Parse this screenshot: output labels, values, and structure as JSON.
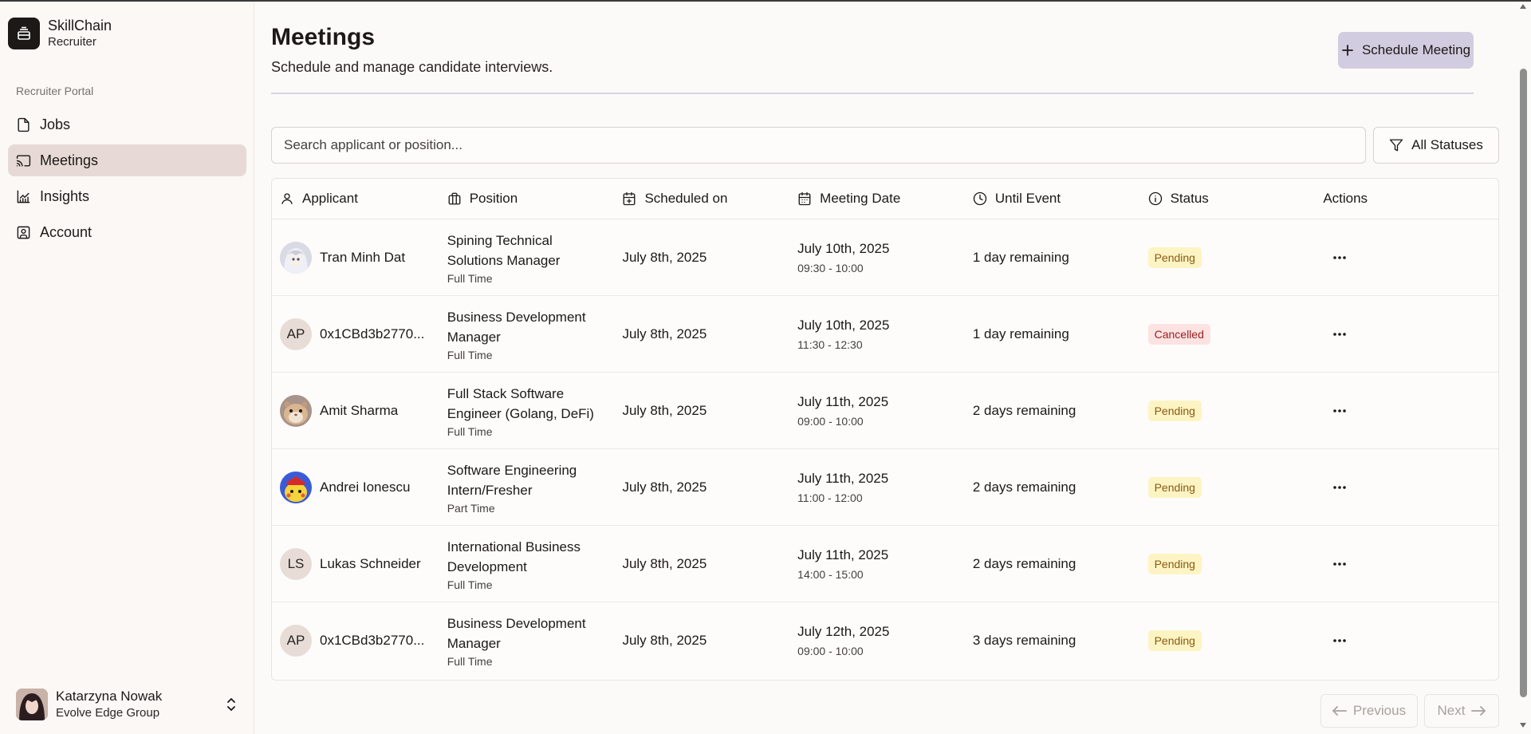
{
  "brand": {
    "name": "SkillChain",
    "subtitle": "Recruiter"
  },
  "sidebar": {
    "section_label": "Recruiter Portal",
    "items": [
      {
        "label": "Jobs",
        "icon": "file-icon",
        "active": false
      },
      {
        "label": "Meetings",
        "icon": "cast-icon",
        "active": true
      },
      {
        "label": "Insights",
        "icon": "chart-icon",
        "active": false
      },
      {
        "label": "Account",
        "icon": "contact-icon",
        "active": false
      }
    ]
  },
  "user": {
    "name": "Katarzyna Nowak",
    "org": "Evolve Edge Group"
  },
  "header": {
    "title": "Meetings",
    "subtitle": "Schedule and manage candidate interviews.",
    "schedule_label": "Schedule Meeting"
  },
  "search": {
    "placeholder": "Search applicant or position..."
  },
  "filter": {
    "label": "All Statuses"
  },
  "table": {
    "headers": [
      "Applicant",
      "Position",
      "Scheduled on",
      "Meeting Date",
      "Until Event",
      "Status",
      "Actions"
    ],
    "rows": [
      {
        "avatar": "anime-avatar-grey",
        "initials": "",
        "applicant": "Tran Minh Dat",
        "position": "Spining Technical Solutions Manager",
        "type": "Full Time",
        "scheduled": "July 8th, 2025",
        "date": "July 10th, 2025",
        "time": "09:30 - 10:00",
        "until": "1 day remaining",
        "status": "Pending"
      },
      {
        "avatar": "initials",
        "initials": "AP",
        "applicant": "0x1CBd3b2770...",
        "position": "Business Development Manager",
        "type": "Full Time",
        "scheduled": "July 8th, 2025",
        "date": "July 10th, 2025",
        "time": "11:30 - 12:30",
        "until": "1 day remaining",
        "status": "Cancelled"
      },
      {
        "avatar": "hamster-photo",
        "initials": "",
        "applicant": "Amit Sharma",
        "position": "Full Stack Software Engineer (Golang, DeFi)",
        "type": "Full Time",
        "scheduled": "July 8th, 2025",
        "date": "July 11th, 2025",
        "time": "09:00 - 10:00",
        "until": "2 days remaining",
        "status": "Pending"
      },
      {
        "avatar": "yellow-cartoon",
        "initials": "",
        "applicant": "Andrei Ionescu",
        "position": "Software Engineering Intern/Fresher",
        "type": "Part Time",
        "scheduled": "July 8th, 2025",
        "date": "July 11th, 2025",
        "time": "11:00 - 12:00",
        "until": "2 days remaining",
        "status": "Pending"
      },
      {
        "avatar": "initials",
        "initials": "LS",
        "applicant": "Lukas Schneider",
        "position": "International Business Development",
        "type": "Full Time",
        "scheduled": "July 8th, 2025",
        "date": "July 11th, 2025",
        "time": "14:00 - 15:00",
        "until": "2 days remaining",
        "status": "Pending"
      },
      {
        "avatar": "initials",
        "initials": "AP",
        "applicant": "0x1CBd3b2770...",
        "position": "Business Development Manager",
        "type": "Full Time",
        "scheduled": "July 8th, 2025",
        "date": "July 12th, 2025",
        "time": "09:00 - 10:00",
        "until": "3 days remaining",
        "status": "Pending"
      }
    ]
  },
  "pagination": {
    "previous": "Previous",
    "next": "Next"
  },
  "colors": {
    "accent_button": "#d2cce0",
    "active_nav": "#e7dad6",
    "pending_bg": "#fdf4c4",
    "cancelled_bg": "#fde2e2"
  }
}
